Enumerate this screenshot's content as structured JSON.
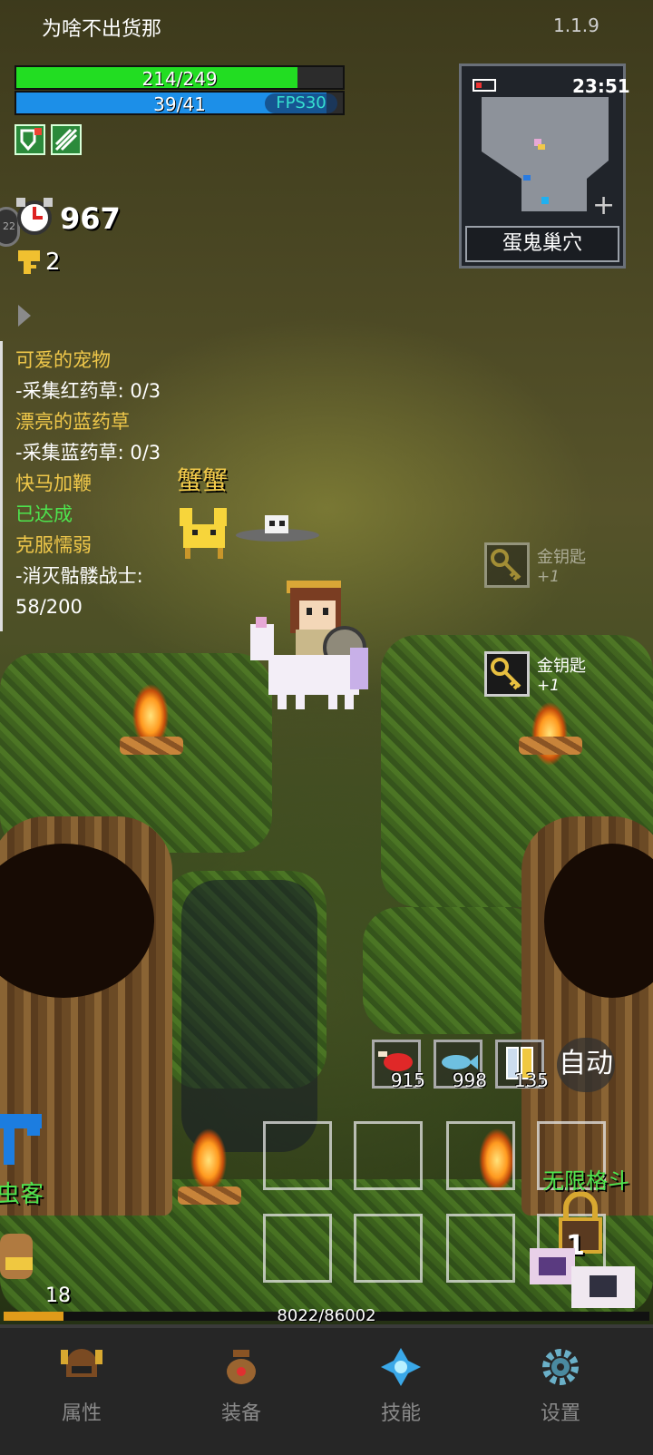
{
  "header": {
    "title": "为啥不出货那",
    "version": "1.1.9"
  },
  "status": {
    "hp": "214/249",
    "hp_fraction": 0.86,
    "mp": "39/41",
    "mp_fraction": 0.95,
    "fps": "FPS30"
  },
  "counters": {
    "timer_value": "967",
    "timer_badge": "22",
    "keys": "2"
  },
  "minimap": {
    "clock": "23:51",
    "area_name": "蛋鬼巢穴",
    "expand_symbol": "+"
  },
  "quests": [
    {
      "title": "可爱的宠物",
      "detail": "-采集红药草: 0/3"
    },
    {
      "title": "漂亮的蓝药草",
      "detail": "-采集蓝药草: 0/3"
    },
    {
      "title": "快马加鞭",
      "detail": "已达成"
    },
    {
      "title": "克服懦弱",
      "detail": "-消灭骷髅战士:",
      "detail2": "58/200"
    }
  ],
  "world": {
    "enemy_name": "蟹蟹",
    "pet_name": "虫客",
    "pet_level": "18"
  },
  "loot_feed": [
    {
      "name": "金钥匙",
      "amount": "+1"
    },
    {
      "name": "金钥匙",
      "amount": "+1"
    }
  ],
  "consumables": [
    {
      "icon": "meat-icon",
      "count": "915"
    },
    {
      "icon": "fish-icon",
      "count": "998"
    },
    {
      "icon": "potion-icon",
      "count": "135"
    }
  ],
  "auto_button": "自动",
  "skills": {
    "label": "无限格斗",
    "cooldown": "1"
  },
  "experience": {
    "text": "8022/86002",
    "fraction": 0.093
  },
  "nav": [
    {
      "label": "属性",
      "icon": "helmet-icon"
    },
    {
      "label": "装备",
      "icon": "bag-icon"
    },
    {
      "label": "技能",
      "icon": "crystal-icon"
    },
    {
      "label": "设置",
      "icon": "gear-icon"
    }
  ],
  "colors": {
    "hp": "#22dd22",
    "mp": "#1c8fe8",
    "quest_title": "#f0c84a",
    "quest_done": "#4ee44e",
    "exp": "#e09b1a"
  }
}
